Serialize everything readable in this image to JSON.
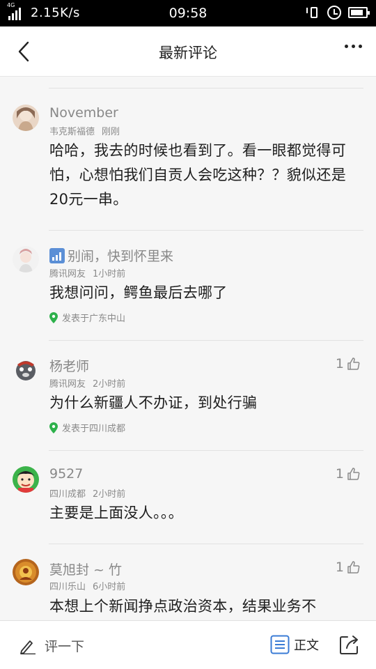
{
  "status_bar": {
    "network_tag": "4G",
    "speed": "2.15K/s",
    "time": "09:58"
  },
  "header": {
    "title": "最新评论"
  },
  "comments": [
    {
      "name": "November",
      "source": "韦克斯福德",
      "time": "刚刚",
      "text": "哈哈，我去的时候也看到了。看一眼都觉得可怕，心想怕我们自贡人会吃这种？？貌似还是20元一串。"
    },
    {
      "name": "别闹，快到怀里来",
      "source": "腾讯网友",
      "time": "1小时前",
      "text": "我想问问，鳄鱼最后去哪了",
      "location": "发表于广东中山"
    },
    {
      "name": "杨老师",
      "source": "腾讯网友",
      "time": "2小时前",
      "text": "为什么新疆人不办证，到处行骗",
      "location": "发表于四川成都",
      "likes": "1"
    },
    {
      "name": "9527",
      "source": "四川成都",
      "time": "2小时前",
      "text": "主要是上面没人。。。",
      "likes": "1"
    },
    {
      "name": "莫旭封 ~ 竹",
      "source": "四川乐山",
      "time": "6小时前",
      "text": "本想上个新闻挣点政治资本，结果业务不",
      "likes": "1"
    }
  ],
  "bottom_bar": {
    "comment_placeholder": "评一下",
    "article_label": "正文"
  },
  "colors": {
    "location_pin": "#2db14b",
    "vip_badge": "#3a7bd5"
  }
}
